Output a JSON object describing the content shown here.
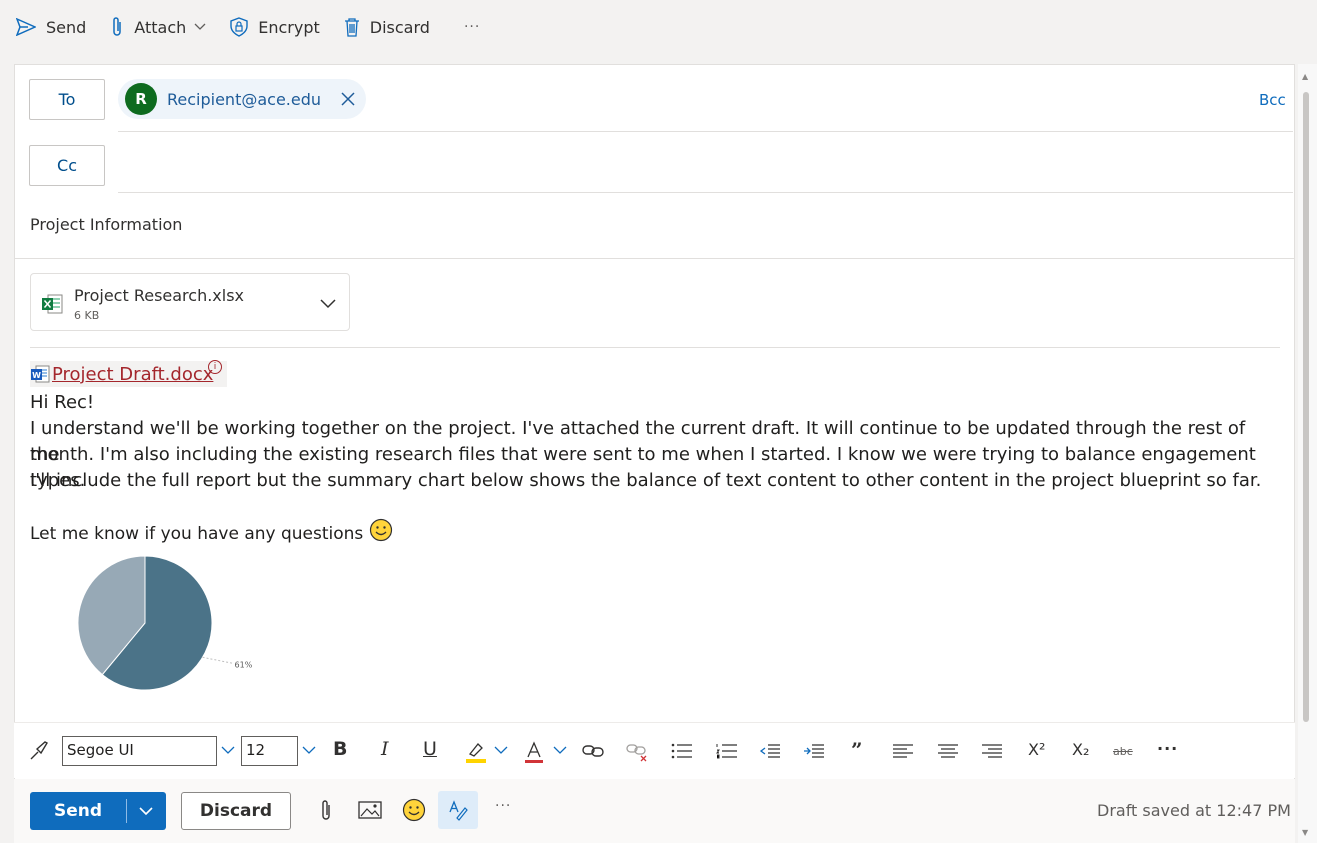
{
  "toolbar": {
    "send_label": "Send",
    "attach_label": "Attach",
    "encrypt_label": "Encrypt",
    "discard_label": "Discard",
    "more_label": "···"
  },
  "header": {
    "to_label": "To",
    "cc_label": "Cc",
    "bcc_label": "Bcc",
    "recipient": {
      "initial": "R",
      "email": "Recipient@ace.edu",
      "avatar_color": "#0e6b1f"
    },
    "subject": "Project Information"
  },
  "attachment": {
    "name": "Project Research.xlsx",
    "size": "6 KB",
    "icon": "excel-icon"
  },
  "body": {
    "linked_doc": "Project Draft.docx",
    "greeting": "Hi Rec!",
    "paragraph_line1": "I understand we'll be working together on the project. I've attached the current draft. It will continue to be updated through the rest of the",
    "paragraph_line2": "month. I'm also including the existing research files that were sent to me when I started. I know we were trying to balance engagement types.",
    "paragraph_line3": "I'll include the full report but the summary chart below shows the balance of text content to other content in the project blueprint so far.",
    "closing": "Let me know if you have any questions",
    "emoji": "smile-emoji"
  },
  "chart_data": {
    "type": "pie",
    "values": [
      61,
      39
    ],
    "data_labels": [
      "61%"
    ],
    "colors": [
      "#4b7388",
      "#97a9b6"
    ]
  },
  "format_bar": {
    "font_family": "Segoe UI",
    "font_size": "12",
    "superscript": "X²",
    "subscript": "X₂",
    "strike": "abc",
    "more": "···"
  },
  "send_bar": {
    "send_label": "Send",
    "discard_label": "Discard",
    "more_label": "···",
    "status": "Draft saved at 12:47 PM"
  }
}
